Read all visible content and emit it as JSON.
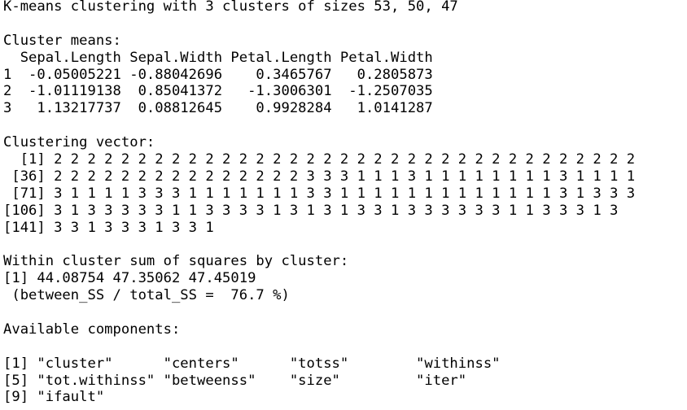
{
  "console": {
    "lines": [
      "K-means clustering with 3 clusters of sizes 53, 50, 47",
      "",
      "Cluster means:",
      "  Sepal.Length Sepal.Width Petal.Length Petal.Width",
      "1  -0.05005221 -0.88042696    0.3465767   0.2805873",
      "2  -1.01119138  0.85041372   -1.3006301  -1.2507035",
      "3   1.13217737  0.08812645    0.9928284   1.0141287",
      "",
      "Clustering vector:",
      "  [1] 2 2 2 2 2 2 2 2 2 2 2 2 2 2 2 2 2 2 2 2 2 2 2 2 2 2 2 2 2 2 2 2 2 2 2",
      " [36] 2 2 2 2 2 2 2 2 2 2 2 2 2 2 2 3 3 3 1 1 1 3 1 1 1 1 1 1 1 1 3 1 1 1 1",
      " [71] 3 1 1 1 1 3 3 3 1 1 1 1 1 1 1 3 3 1 1 1 1 1 1 1 1 1 1 1 1 1 3 1 3 3 3",
      "[106] 3 1 3 3 3 3 3 1 1 3 3 3 3 1 3 1 3 1 3 3 1 3 3 3 3 3 3 1 1 3 3 3 1 3",
      "[141] 3 3 1 3 3 3 1 3 3 1",
      "",
      "Within cluster sum of squares by cluster:",
      "[1] 44.08754 47.35062 47.45019",
      " (between_SS / total_SS =  76.7 %)",
      "",
      "Available components:",
      "",
      "[1] \"cluster\"      \"centers\"      \"totss\"        \"withinss\"",
      "[5] \"tot.withinss\" \"betweenss\"    \"size\"         \"iter\"",
      "[9] \"ifault\""
    ]
  }
}
